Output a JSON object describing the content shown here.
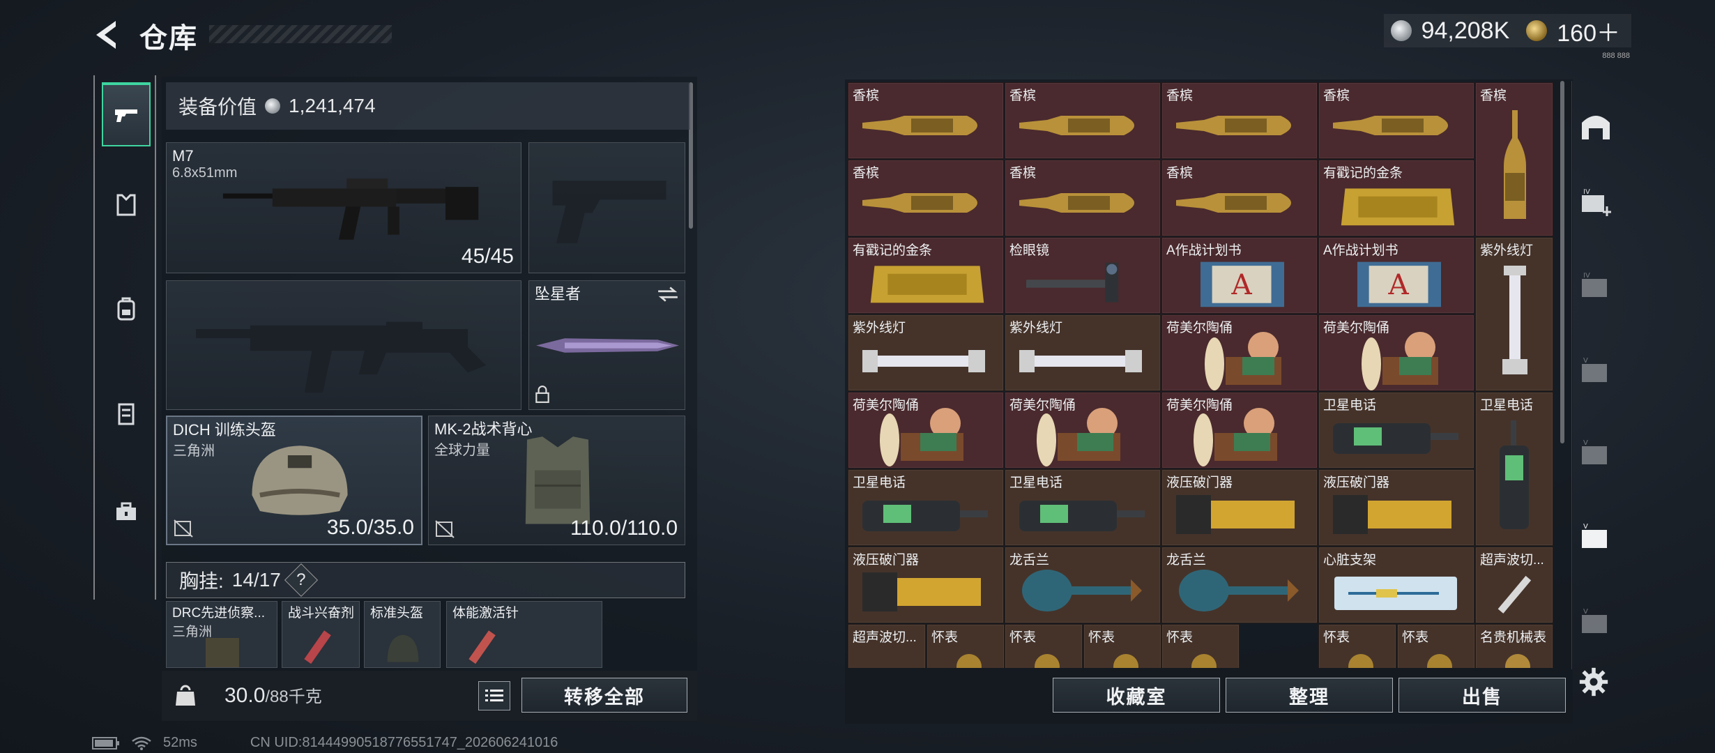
{
  "header": {
    "title": "仓库",
    "silver": "94,208K",
    "gold": "160＋",
    "version": "888 888"
  },
  "side_tabs": [
    "weapons-icon",
    "armor-vest-icon",
    "backpack-icon",
    "chest-rig-icon",
    "toolbox-icon"
  ],
  "equip": {
    "value_label": "装备价值",
    "value": "1,241,474",
    "primary": {
      "name": "M7",
      "ammo": "6.8x51mm",
      "count": "45/45"
    },
    "melee": {
      "name": "坠星者"
    },
    "helmet": {
      "name": "DICH 训练头盔",
      "faction": "三角洲",
      "durability": "35.0/35.0"
    },
    "vest": {
      "name": "MK-2战术背心",
      "faction": "全球力量",
      "durability": "110.0/110.0"
    },
    "chest_label": "胸挂:",
    "chest_count": "14/17",
    "chest_help": "?",
    "chest_items": [
      {
        "name": "DRC先进侦察...",
        "sub": "三角洲"
      },
      {
        "name": "战斗兴奋剂",
        "sub": ""
      },
      {
        "name": "标准头盔",
        "sub": ""
      },
      {
        "name": "体能激活针",
        "sub": ""
      }
    ],
    "weight": "30.0",
    "weight_max": "/88千克",
    "transfer_all": "转移全部"
  },
  "storage": {
    "items": [
      "香槟",
      "香槟",
      "香槟",
      "香槟",
      "香槟",
      "香槟",
      "香槟",
      "香槟",
      "有戳记的金条",
      "有戳记的金条",
      "检眼镜",
      "A作战计划书",
      "A作战计划书",
      "紫外线灯",
      "紫外线灯",
      "紫外线灯",
      "荷美尔陶俑",
      "荷美尔陶俑",
      "荷美尔陶俑",
      "荷美尔陶俑",
      "荷美尔陶俑",
      "卫星电话",
      "卫星电话",
      "卫星电话",
      "卫星电话",
      "液压破门器",
      "液压破门器",
      "液压破门器",
      "龙舌兰",
      "龙舌兰",
      "心脏支架",
      "超声波切...",
      "超声波切...",
      "怀表",
      "怀表",
      "怀表",
      "怀表",
      "怀表",
      "怀表",
      "名贵机械表"
    ],
    "buttons": {
      "collection": "收藏室",
      "sort": "整理",
      "sell": "出售"
    }
  },
  "right_tabs": [
    "bunker-icon",
    "ammo-case-add-icon",
    "ammo-case-icon",
    "ammo-case-icon",
    "ammo-case-icon",
    "ammo-case-icon",
    "ammo-case-icon"
  ],
  "status": {
    "ping": "52ms",
    "uid": "CN UID:8144499051877655​1747_202606241016"
  },
  "colors": {
    "accent": "#3fd5a0",
    "cell_red": "#4a2a2e",
    "cell_brown": "#45332a"
  }
}
